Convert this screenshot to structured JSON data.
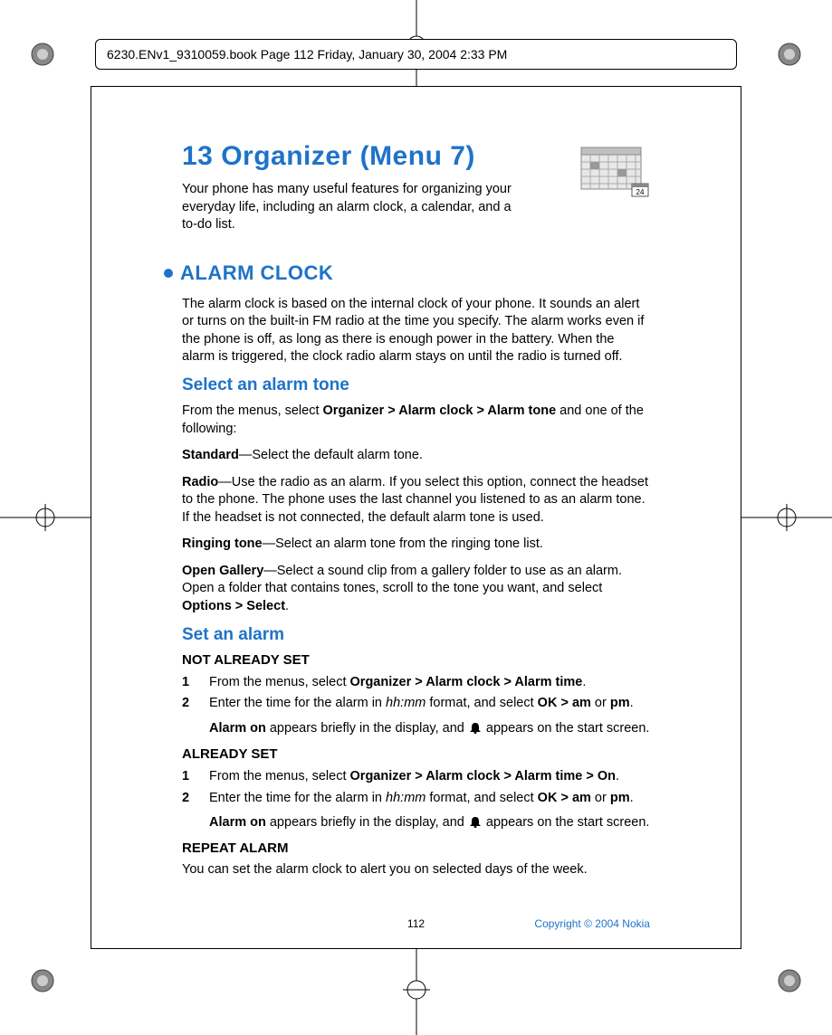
{
  "book_info": "6230.ENv1_9310059.book  Page 112  Friday, January 30, 2004  2:33 PM",
  "chapter": {
    "title": "13 Organizer (Menu 7)",
    "intro": "Your phone has many useful features for organizing your everyday life, including an alarm clock, a calendar, and a to-do list."
  },
  "alarm_clock": {
    "heading": "ALARM CLOCK",
    "intro": "The alarm clock is based on the internal clock of your phone. It sounds an alert or turns on the built-in FM radio at the time you specify. The alarm works even if the phone is off, as long as there is enough power in the battery. When the alarm is triggered, the clock radio alarm stays on until the radio is turned off.",
    "select_tone": {
      "heading": "Select an alarm tone",
      "intro_prefix": "From the menus, select ",
      "intro_bold": "Organizer > Alarm clock > Alarm tone",
      "intro_suffix": " and one of the following:",
      "options": {
        "standard": {
          "label": "Standard",
          "desc": "—Select the default alarm tone."
        },
        "radio": {
          "label": "Radio",
          "desc": "—Use the radio as an alarm. If you select this option, connect the headset to the phone. The phone uses the last channel you listened to as an alarm tone. If the headset is not connected, the default alarm tone is used."
        },
        "ringing": {
          "label": "Ringing tone",
          "desc": "—Select an alarm tone from the ringing tone list."
        },
        "gallery": {
          "label": "Open Gallery",
          "desc_prefix": "—Select a sound clip from a gallery folder to use as an alarm. Open a folder that contains tones, scroll to the tone you want, and select ",
          "desc_bold": "Options > Select",
          "desc_suffix": "."
        }
      }
    },
    "set_alarm": {
      "heading": "Set an alarm",
      "not_set": {
        "heading": "NOT ALREADY SET",
        "step1_prefix": "From the menus, select ",
        "step1_bold": "Organizer > Alarm clock > Alarm time",
        "step1_suffix": ".",
        "step2_prefix": "Enter the time for the alarm in ",
        "step2_italic": "hh:mm",
        "step2_mid": " format, and select ",
        "step2_bold1": "OK > am",
        "step2_or": " or ",
        "step2_bold2": "pm",
        "step2_suffix": ".",
        "followup_bold": "Alarm on",
        "followup_mid": " appears briefly in the display, and ",
        "followup_suffix": " appears on the start screen."
      },
      "already_set": {
        "heading": "ALREADY SET",
        "step1_prefix": "From the menus, select ",
        "step1_bold": "Organizer > Alarm clock > Alarm time > On",
        "step1_suffix": ".",
        "step2_prefix": "Enter the time for the alarm in ",
        "step2_italic": "hh:mm",
        "step2_mid": " format, and select ",
        "step2_bold1": "OK > am",
        "step2_or": " or ",
        "step2_bold2": "pm",
        "step2_suffix": ".",
        "followup_bold": "Alarm on",
        "followup_mid": " appears briefly in the display, and ",
        "followup_suffix": " appears on the start screen."
      },
      "repeat": {
        "heading": "REPEAT ALARM",
        "body": "You can set the alarm clock to alert you on selected days of the week."
      }
    }
  },
  "footer": {
    "page": "112",
    "copyright": "Copyright © 2004 Nokia"
  }
}
